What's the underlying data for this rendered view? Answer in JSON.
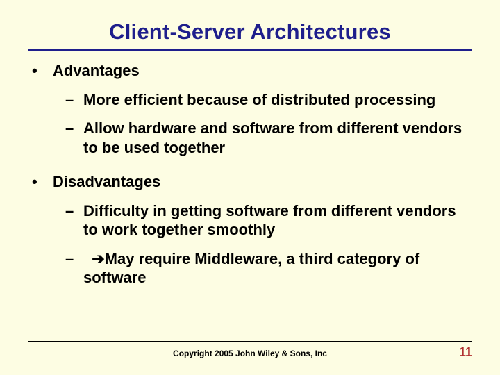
{
  "title": "Client-Server Architectures",
  "sections": [
    {
      "heading": "Advantages",
      "items": [
        {
          "text": "More efficient because of distributed processing"
        },
        {
          "text": "Allow hardware and software from different vendors to be used together"
        }
      ]
    },
    {
      "heading": "Disadvantages",
      "items": [
        {
          "text": "Difficulty in getting software from different vendors to work together smoothly"
        },
        {
          "arrow": true,
          "text": "May require Middleware, a third category of software"
        }
      ]
    }
  ],
  "footer": {
    "copyright": "Copyright 2005 John Wiley & Sons, Inc",
    "page": "11"
  }
}
